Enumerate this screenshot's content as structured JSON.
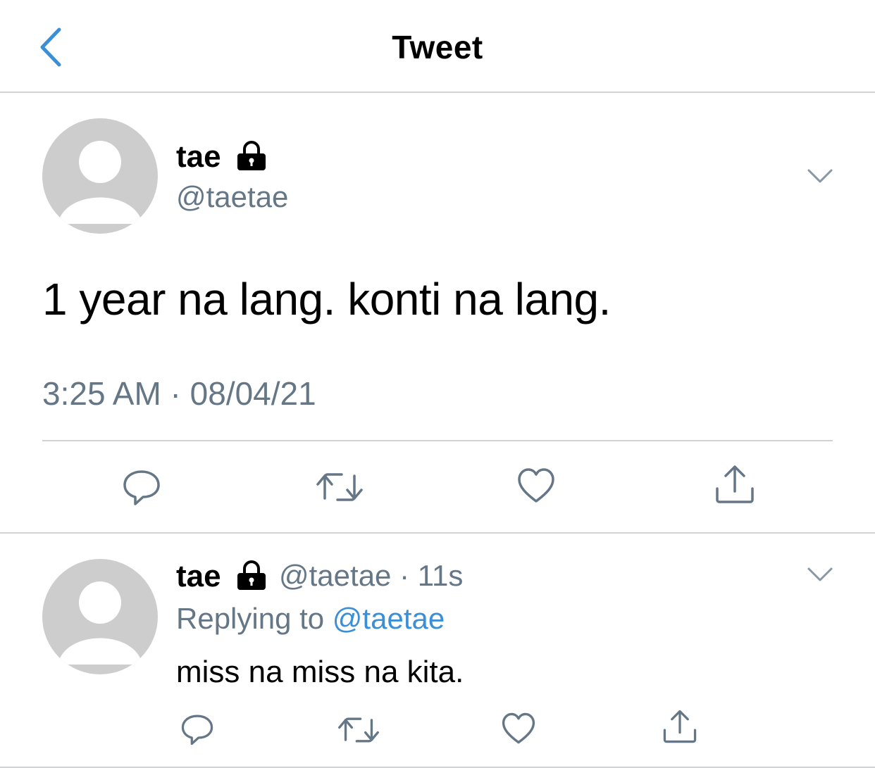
{
  "header": {
    "title": "Tweet",
    "back_icon": "chevron-left-icon"
  },
  "colors": {
    "accent": "#3a8fd6",
    "secondary_text": "#657786",
    "divider": "#cfd3d6",
    "avatar": "#cdcdcd"
  },
  "main_tweet": {
    "name": "tae",
    "handle": "@taetae",
    "text": "1 year na lang. konti na lang.",
    "timestamp": "3:25 AM · 08/04/21",
    "actions": [
      "reply-icon",
      "retweet-icon",
      "like-icon",
      "share-icon"
    ]
  },
  "reply": {
    "name": "tae",
    "handle_time": "@taetae · 11s",
    "replying_prefix": "Replying to ",
    "replying_to": "@taetae",
    "text": "miss na miss na kita.",
    "actions": [
      "reply-icon",
      "retweet-icon",
      "like-icon",
      "share-icon"
    ]
  }
}
